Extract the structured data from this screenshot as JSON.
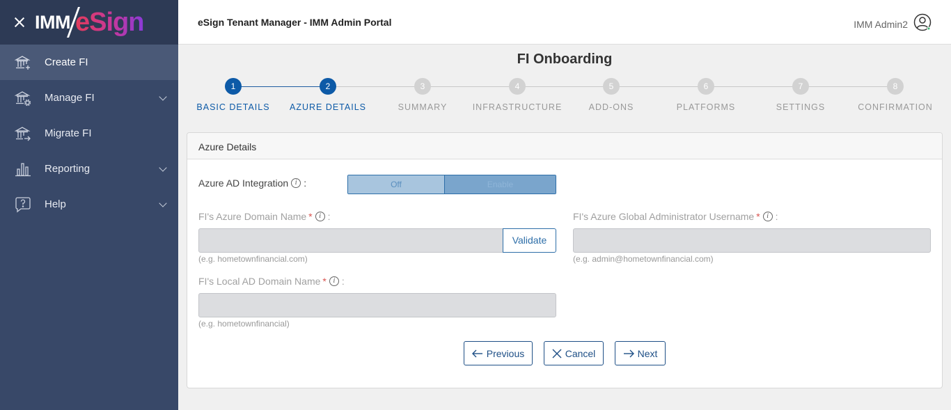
{
  "header": {
    "title": "eSign Tenant Manager - IMM Admin Portal",
    "user_name": "IMM Admin2"
  },
  "logo": {
    "part1": "IMM",
    "part2": "eSign"
  },
  "sidebar": {
    "items": [
      {
        "label": "Create FI",
        "icon": "bank-add-icon"
      },
      {
        "label": "Manage FI",
        "icon": "bank-gear-icon"
      },
      {
        "label": "Migrate FI",
        "icon": "bank-arrow-icon"
      },
      {
        "label": "Reporting",
        "icon": "bar-chart-icon"
      },
      {
        "label": "Help",
        "icon": "help-chat-icon"
      }
    ]
  },
  "page_title": "FI Onboarding",
  "steps": [
    {
      "num": "1",
      "label": "BASIC DETAILS"
    },
    {
      "num": "2",
      "label": "AZURE DETAILS"
    },
    {
      "num": "3",
      "label": "SUMMARY"
    },
    {
      "num": "4",
      "label": "INFRASTRUCTURE"
    },
    {
      "num": "5",
      "label": "ADD-ONS"
    },
    {
      "num": "6",
      "label": "PLATFORMS"
    },
    {
      "num": "7",
      "label": "SETTINGS"
    },
    {
      "num": "8",
      "label": "CONFIRMATION"
    }
  ],
  "current_step": 2,
  "card": {
    "title": "Azure Details",
    "azure_ad_label": "Azure AD Integration",
    "toggle_off": "Off",
    "toggle_on": "Enable",
    "domain_label": "FI's Azure Domain Name",
    "domain_value": "",
    "domain_hint": "(e.g. hometownfinancial.com)",
    "validate_label": "Validate",
    "admin_label": "FI's Azure Global Administrator Username",
    "admin_value": "",
    "admin_hint": "(e.g. admin@hometownfinancial.com)",
    "local_label": "FI's Local AD Domain Name",
    "local_value": "",
    "local_hint": "(e.g. hometownfinancial)"
  },
  "buttons": {
    "previous": "Previous",
    "cancel": "Cancel",
    "next": "Next"
  },
  "colors": {
    "sidebar": "#384868",
    "accent": "#0d5aa7",
    "required": "#d9534f"
  }
}
